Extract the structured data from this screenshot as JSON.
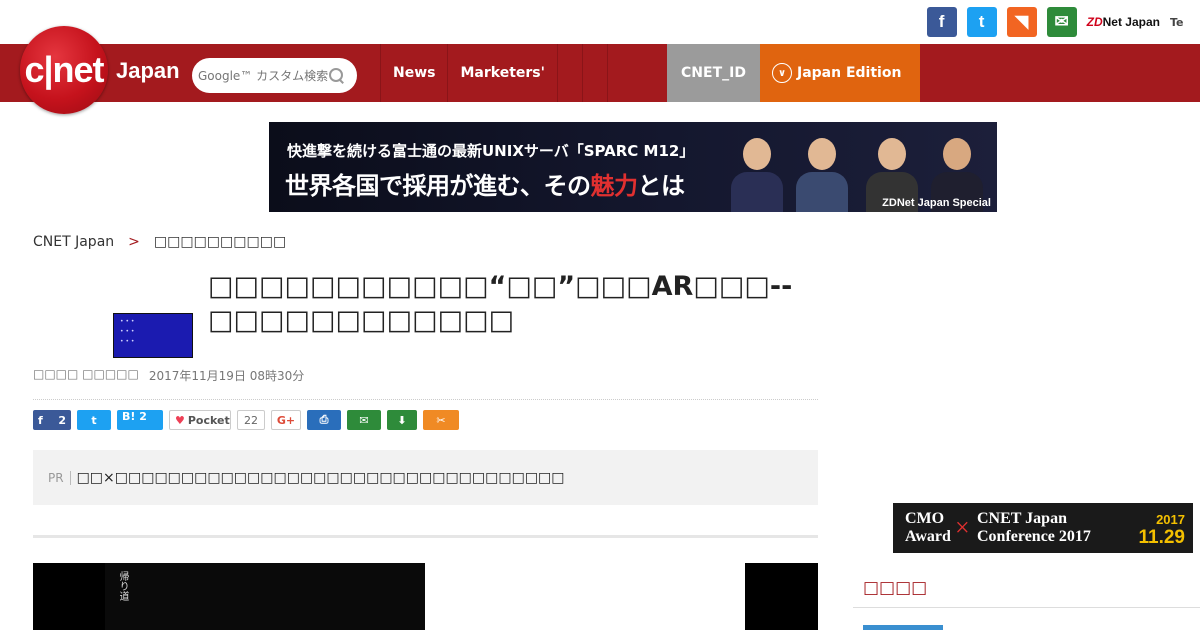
{
  "social": {
    "facebook_glyph": "f",
    "twitter_glyph": "t",
    "rss_glyph": "◥",
    "mail_glyph": "✉",
    "zdnet_prefix": "ZD",
    "zdnet_suffix": "Net Japan",
    "te_label": "Te"
  },
  "header": {
    "logo_text": "c|net",
    "logo_sub": "Japan",
    "search_placeholder": "Google™ カスタム検索",
    "nav": [
      "News",
      "Marketers'"
    ],
    "cnetid": "CNET_ID",
    "edition": "Japan Edition",
    "edition_icon": "∨"
  },
  "banner": {
    "line1": "快進撃を続ける富士通の最新UNIXサーバ「SPARC M12」",
    "line2_a": "世界各国で採用が進む、その",
    "line2_hl": "魅力",
    "line2_b": "とは",
    "tag": "ZDNet Japan Special"
  },
  "breadcrumb": {
    "home": "CNET Japan",
    "sep": ">",
    "section": "□□□□□□□□□□"
  },
  "article": {
    "headline": "□□□□□□□□□□□“□□”□□□AR□□□--□□□□□□□□□□□□",
    "author": "□□□□ □□□□□",
    "date": "2017年11月19日 08時30分"
  },
  "share": {
    "fb_count": "2",
    "hatena_label": "B!",
    "hatena_count": "2",
    "pocket_label": "Pocket",
    "pocket_count": "22",
    "gplus_label": "G+",
    "print_glyph": "⎙",
    "mail_glyph": "✉",
    "save_glyph": "⬇",
    "clip_glyph": "✂"
  },
  "pr": {
    "label": "PR",
    "text": "□□×□□□□□□□□□□□□□□□□□□□□□□□□□□□□□□□□□□"
  },
  "media": {
    "vertical_text": "帰り道"
  },
  "cmo": {
    "a": "CMO Award",
    "x": "×",
    "b": "CNET Japan Conference 2017",
    "year": "2017",
    "date": "11.29"
  },
  "sidebar": {
    "heading": "□□□□"
  },
  "colors": {
    "brand_red": "#a31a1e",
    "edition_orange": "#e0640f",
    "cnetid_gray": "#9b9b9b"
  }
}
